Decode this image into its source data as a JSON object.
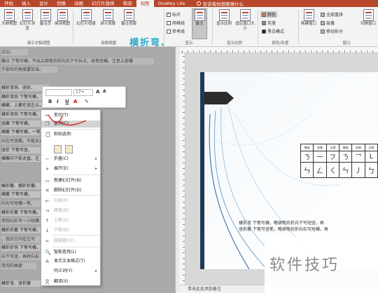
{
  "tabs": [
    "开始",
    "插入",
    "设计",
    "切换",
    "动画",
    "幻灯片放映",
    "审阅",
    "视图",
    "OneKey Lite"
  ],
  "active_tab": "视图",
  "tell_me": "告诉我你想要做什么",
  "ribbon": {
    "view_buttons": [
      "大纲视图",
      "幻灯片浏览",
      "备注页",
      "阅读视图"
    ],
    "master_buttons": [
      "幻灯片母版",
      "讲义母版",
      "备注母版"
    ],
    "show_checks": [
      {
        "label": "标尺",
        "checked": true
      },
      {
        "label": "网格线",
        "checked": false
      },
      {
        "label": "参考线",
        "checked": false
      }
    ],
    "notes_button": "备注",
    "zoom_buttons": [
      "显示比例",
      "适应窗口大小"
    ],
    "color_options": [
      {
        "label": "颜色",
        "color": "#e07a4a"
      },
      {
        "label": "灰度",
        "color": "#8a8a8a"
      },
      {
        "label": "黑白模式",
        "color": "#222222"
      }
    ],
    "window_options": [
      "全部重排",
      "层叠",
      "移动拆分"
    ],
    "new_window": "新建窗口",
    "switch_window": "切换窗口",
    "groups": [
      "演示文稿视图",
      "母版视图",
      "显示",
      "显示比例",
      "颜色/灰度",
      "窗口"
    ]
  },
  "outline_lines": [
    "点尖。",
    "横点  下笔写横，不出尖顿笔后折向右下写长点，收笔短横。注意上部横",
    "于部长的角度要恰当。",
    "",
    "横折弯钩、竖折、",
    "横折弯钩  下笔写横，",
    "横撇，上撇在竖左以，",
    "横折弯钩  下笔写横，",
    "竖撇 下笔写横，",
    "横撇  下横写横，一笔写成",
    "向左写竖撇，不能太直。",
    "竖折  下笔写竖，",
    "横撇向下能太直。注",
    "",
    "",
    "横折撇、横折折撇、",
    "横撇  下笔写横，",
    "向右写短横一笔，",
    "横折折撇  下笔写横，",
    "弯钩向右写一小短横",
    "横折折撇  下笔写横，",
    "，我的方向往左写",
    "横折折钩  下笔写横，",
    "向下写竖，再转向右",
    "弯钩的曲度",
    "",
    "横折弯、竖折撇"
  ],
  "mini_toolbar": {
    "font_name": "",
    "font_size": "17+",
    "buttons": [
      "B",
      "I",
      "U",
      "A"
    ]
  },
  "context_menu": [
    {
      "label": "剪切(T)",
      "icon": "✂",
      "disabled": false,
      "highlighted": false,
      "arrow": false
    },
    {
      "label": "复制(C)",
      "icon": "❐",
      "disabled": false,
      "highlighted": true,
      "arrow": false
    },
    {
      "label": "粘贴选项:",
      "icon": "📋",
      "disabled": false,
      "highlighted": false,
      "arrow": false
    },
    {
      "label": "折叠(C)",
      "icon": "−",
      "disabled": false,
      "highlighted": false,
      "arrow": true
    },
    {
      "label": "展开(E)",
      "icon": "+",
      "disabled": false,
      "highlighted": false,
      "arrow": true
    },
    {
      "label": "新建幻灯片(N)",
      "icon": "▭",
      "disabled": false,
      "highlighted": false,
      "arrow": false
    },
    {
      "label": "删除幻灯片(D)",
      "icon": "✕",
      "disabled": false,
      "highlighted": false,
      "arrow": false
    },
    {
      "label": "升级(P)",
      "icon": "←",
      "disabled": true,
      "highlighted": false,
      "arrow": false
    },
    {
      "label": "降级(D)",
      "icon": "→",
      "disabled": true,
      "highlighted": false,
      "arrow": false
    },
    {
      "label": "上移(U)",
      "icon": "↑",
      "disabled": true,
      "highlighted": false,
      "arrow": false
    },
    {
      "label": "下移(D)",
      "icon": "↓",
      "disabled": true,
      "highlighted": false,
      "arrow": false
    },
    {
      "label": "超链接(H)...",
      "icon": "∞",
      "disabled": true,
      "highlighted": false,
      "arrow": false
    },
    {
      "label": "智能查找(L)",
      "icon": "🔍",
      "disabled": false,
      "highlighted": false,
      "arrow": false
    },
    {
      "label": "显示文本格式(T)",
      "icon": "A",
      "disabled": false,
      "highlighted": false,
      "arrow": false
    },
    {
      "label": "同义词(Y)",
      "icon": "",
      "disabled": false,
      "highlighted": false,
      "arrow": true
    },
    {
      "label": "翻译(S)",
      "icon": "文",
      "disabled": false,
      "highlighted": false,
      "arrow": false
    }
  ],
  "slide": {
    "title": "横折弯、",
    "table_header": [
      "笔画",
      "名称",
      "示例",
      "笔画",
      "名称",
      "示例"
    ],
    "table_row1": [
      "ㄋ",
      "一",
      "フ",
      "ㄋ",
      "乛",
      "L"
    ],
    "table_row2": [
      "ㄣ",
      "ㄥ",
      "ㄑ",
      "ㄣ",
      "丿",
      "ㄅ"
    ],
    "desc1": "横折弯  下笔写横，略顿笔后折向下写短竖，再",
    "desc2": "竖折撇  下笔写竖笔，略顿笔后折向右写短横，再"
  },
  "notes_placeholder": "单击此处添加备注",
  "watermark": "软件技巧"
}
